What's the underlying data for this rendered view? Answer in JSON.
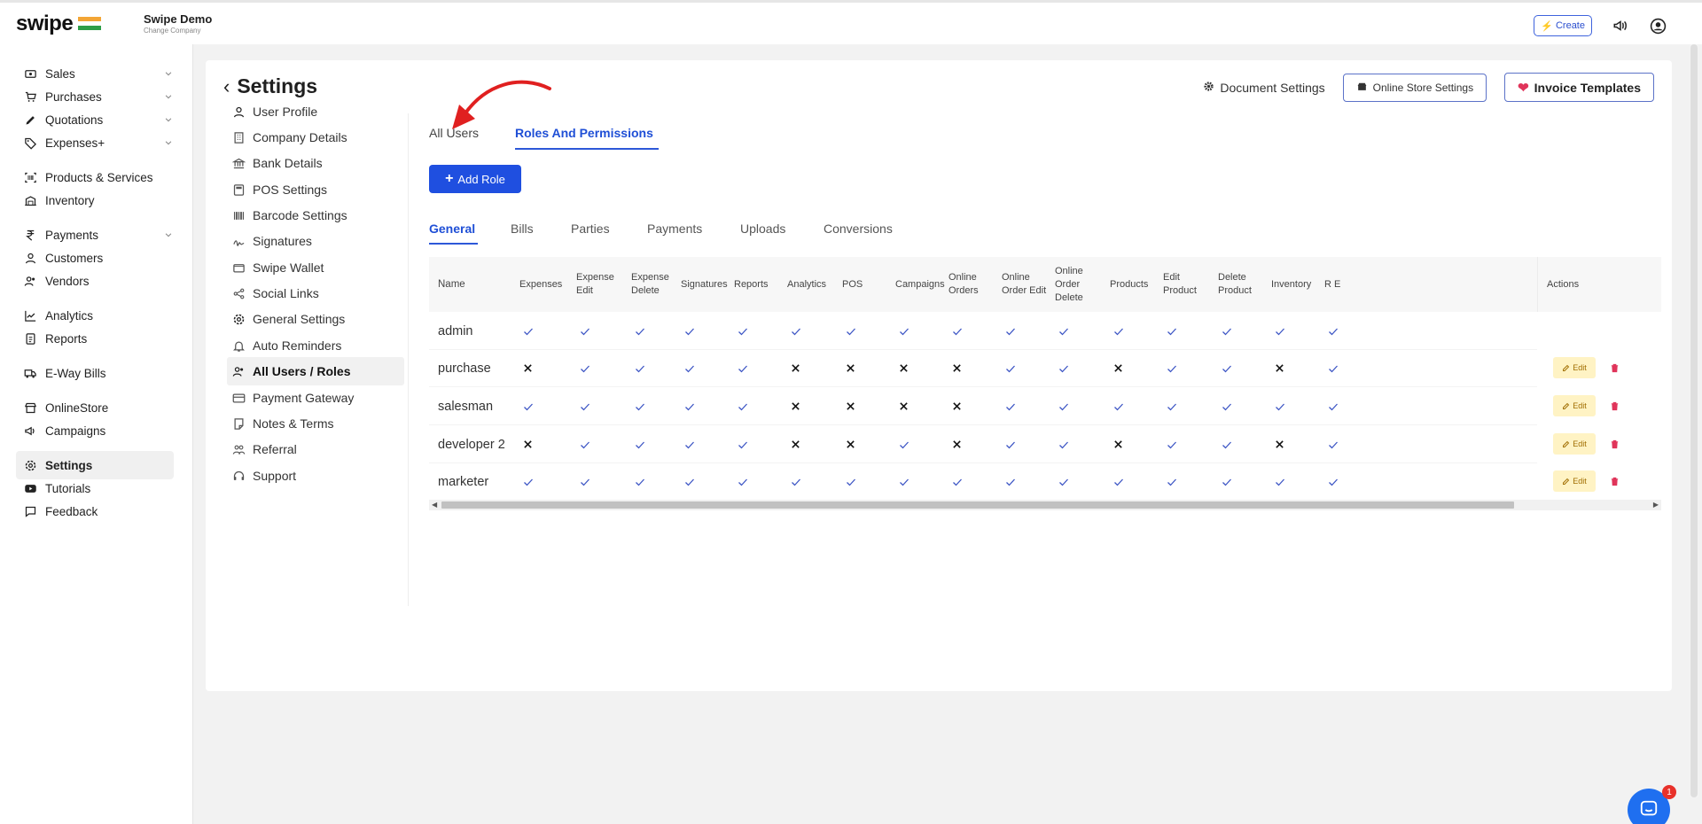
{
  "header": {
    "logo_text": "swipe",
    "company_name": "Swipe Demo",
    "company_sub": "Change Company",
    "create_label": "Create"
  },
  "sidebar": {
    "items": [
      {
        "label": "Sales",
        "icon": "cash-icon",
        "has_chevron": true
      },
      {
        "label": "Purchases",
        "icon": "cart-icon",
        "has_chevron": true
      },
      {
        "label": "Quotations",
        "icon": "pen-icon",
        "has_chevron": true
      },
      {
        "label": "Expenses+",
        "icon": "tag-icon",
        "has_chevron": true
      },
      {
        "label": "Products & Services",
        "icon": "barcode-box-icon",
        "has_chevron": false
      },
      {
        "label": "Inventory",
        "icon": "warehouse-icon",
        "has_chevron": false
      },
      {
        "label": "Payments",
        "icon": "rupee-icon",
        "has_chevron": true
      },
      {
        "label": "Customers",
        "icon": "user-icon",
        "has_chevron": false
      },
      {
        "label": "Vendors",
        "icon": "users-icon",
        "has_chevron": false
      },
      {
        "label": "Analytics",
        "icon": "chart-icon",
        "has_chevron": false
      },
      {
        "label": "Reports",
        "icon": "report-icon",
        "has_chevron": false
      },
      {
        "label": "E-Way Bills",
        "icon": "truck-icon",
        "has_chevron": false
      },
      {
        "label": "OnlineStore",
        "icon": "store-icon",
        "has_chevron": false
      },
      {
        "label": "Campaigns",
        "icon": "megaphone-icon",
        "has_chevron": false
      },
      {
        "label": "Settings",
        "icon": "gear-icon",
        "has_chevron": false,
        "active": true
      },
      {
        "label": "Tutorials",
        "icon": "youtube-icon",
        "has_chevron": false
      },
      {
        "label": "Feedback",
        "icon": "message-icon",
        "has_chevron": false
      }
    ]
  },
  "page": {
    "title": "Settings",
    "document_settings": "Document Settings",
    "online_store_settings": "Online Store Settings",
    "invoice_templates": "Invoice Templates"
  },
  "settings_nav": [
    {
      "label": "User Profile",
      "icon": "user-icon"
    },
    {
      "label": "Company Details",
      "icon": "building-icon"
    },
    {
      "label": "Bank Details",
      "icon": "bank-icon"
    },
    {
      "label": "POS Settings",
      "icon": "pos-icon"
    },
    {
      "label": "Barcode Settings",
      "icon": "barcode-icon"
    },
    {
      "label": "Signatures",
      "icon": "signature-icon"
    },
    {
      "label": "Swipe Wallet",
      "icon": "wallet-icon"
    },
    {
      "label": "Social Links",
      "icon": "share-icon"
    },
    {
      "label": "General Settings",
      "icon": "gear-icon"
    },
    {
      "label": "Auto Reminders",
      "icon": "bell-icon"
    },
    {
      "label": "All Users / Roles",
      "icon": "users-icon",
      "active": true
    },
    {
      "label": "Payment Gateway",
      "icon": "card-icon"
    },
    {
      "label": "Notes & Terms",
      "icon": "note-icon"
    },
    {
      "label": "Referral",
      "icon": "referral-icon"
    },
    {
      "label": "Support",
      "icon": "headset-icon"
    }
  ],
  "main_tabs": [
    {
      "label": "All Users",
      "active": false
    },
    {
      "label": "Roles And Permissions",
      "active": true
    }
  ],
  "add_role_label": "Add Role",
  "sub_tabs": [
    {
      "label": "General",
      "active": true
    },
    {
      "label": "Bills"
    },
    {
      "label": "Parties"
    },
    {
      "label": "Payments"
    },
    {
      "label": "Uploads"
    },
    {
      "label": "Conversions"
    }
  ],
  "table": {
    "name_header": "Name",
    "headers": [
      "Expenses",
      "Expense Edit",
      "Expense Delete",
      "Signatures",
      "Reports",
      "Analytics",
      "POS",
      "Campaigns",
      "Online Orders",
      "Online Order Edit",
      "Online Order Delete",
      "Products",
      "Edit Product",
      "Delete Product",
      "Inventory",
      "R E"
    ],
    "actions_header": "Actions",
    "edit_label": "Edit",
    "rows": [
      {
        "name": "admin",
        "perms": [
          1,
          1,
          1,
          1,
          1,
          1,
          1,
          1,
          1,
          1,
          1,
          1,
          1,
          1,
          1,
          1
        ],
        "actions": false
      },
      {
        "name": "purchase",
        "perms": [
          0,
          1,
          1,
          1,
          1,
          0,
          0,
          0,
          0,
          1,
          1,
          0,
          1,
          1,
          0,
          1
        ],
        "actions": true
      },
      {
        "name": "salesman",
        "perms": [
          1,
          1,
          1,
          1,
          1,
          0,
          0,
          0,
          0,
          1,
          1,
          1,
          1,
          1,
          1,
          1
        ],
        "actions": true
      },
      {
        "name": "developer 2",
        "perms": [
          0,
          1,
          1,
          1,
          1,
          0,
          0,
          1,
          0,
          1,
          1,
          0,
          1,
          1,
          0,
          1
        ],
        "actions": true
      },
      {
        "name": "marketer",
        "perms": [
          1,
          1,
          1,
          1,
          1,
          1,
          1,
          1,
          1,
          1,
          1,
          1,
          1,
          1,
          1,
          1
        ],
        "actions": true
      }
    ]
  },
  "chat_badge": "1",
  "colors": {
    "accent": "#1f4fe0",
    "check": "#3a53c4",
    "edit_bg": "#fff3c4",
    "delete": "#e0345a",
    "annotation_arrow": "#e02020"
  }
}
